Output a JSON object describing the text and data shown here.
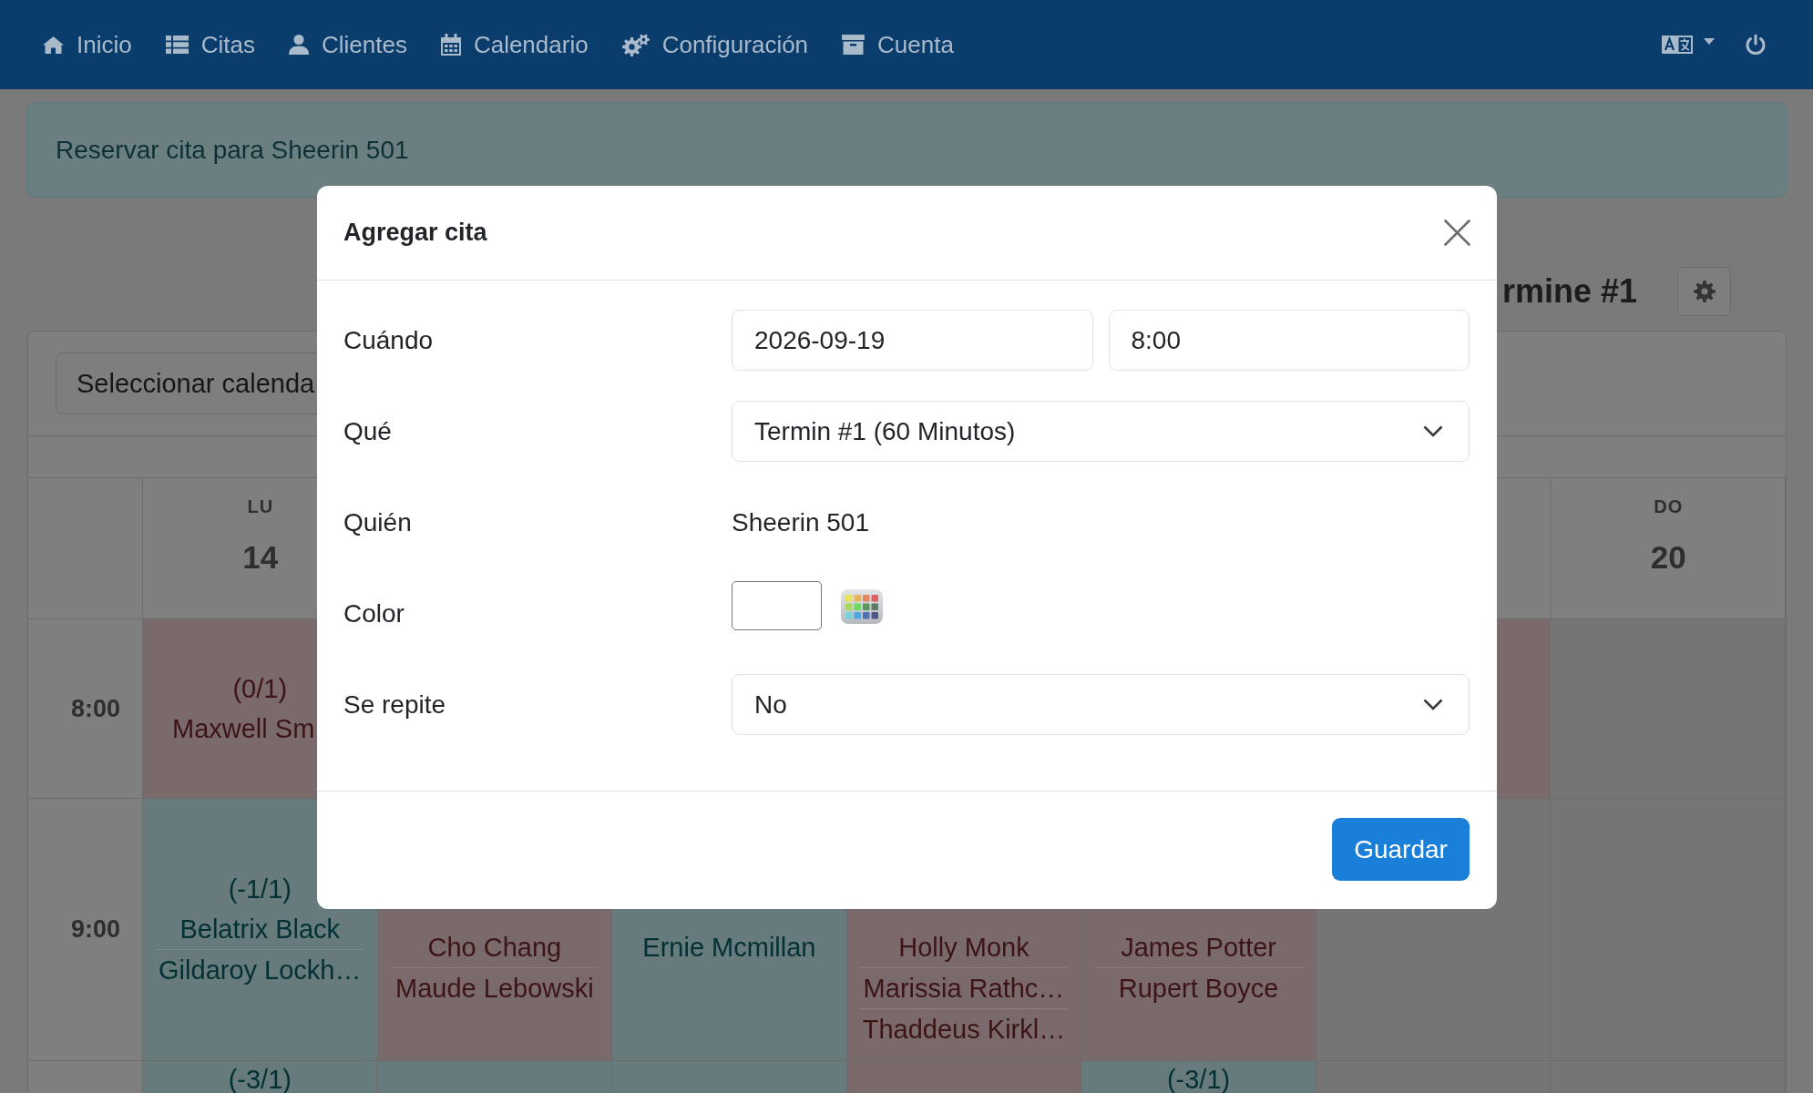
{
  "navbar": {
    "items": [
      "Inicio",
      "Citas",
      "Clientes",
      "Calendario",
      "Configuración",
      "Cuenta"
    ]
  },
  "alert": {
    "text": "Reservar cita para Sheerin 501"
  },
  "calendar": {
    "title": "rmine #1",
    "calendar_select": "Seleccionar calenda",
    "days": [
      {
        "weekday": "LU",
        "date": "14"
      },
      {
        "weekday": "DO",
        "date": "20"
      }
    ],
    "rows": [
      {
        "time": "8:00",
        "cells": [
          {
            "color": "#7b6a6b",
            "count": "(0/1)",
            "names": [
              "Maxwell Sm"
            ]
          },
          {},
          {},
          {},
          {},
          {
            "color": "#7b6a6b"
          },
          {
            "color": "#757577"
          }
        ]
      },
      {
        "time": "9:00",
        "cells": [
          {
            "color": "#677a7c",
            "count": "(-1/1)",
            "names": [
              "Belatrix Black",
              "Gildaroy Lockh…"
            ]
          },
          {
            "color": "#7b6a6b",
            "names": [
              "Cho Chang",
              "Maude Lebowski"
            ]
          },
          {
            "color": "#677a7c",
            "names": [
              "Ernie Mcmillan"
            ]
          },
          {
            "color": "#7b6a6b",
            "names": [
              "Holly Monk",
              "Marissia Rathc…",
              "Thaddeus Kirkl…"
            ]
          },
          {
            "color": "#7b6a6b",
            "names": [
              "James Potter",
              "Rupert Boyce"
            ]
          },
          {
            "color": "#757577"
          },
          {
            "color": "#757577"
          }
        ]
      },
      {
        "cells": [
          {
            "color": "#677a7c",
            "count": "(-3/1)"
          },
          {
            "color": "#677a7c"
          },
          {
            "color": "#677a7c"
          },
          {
            "color": "#7b6a6b"
          },
          {
            "color": "#677a7c",
            "count": "(-3/1)"
          },
          {
            "color": "#757577"
          },
          {
            "color": "#757577"
          }
        ]
      }
    ]
  },
  "dialog": {
    "title": "Agregar cita",
    "fields": [
      {
        "kind": "datetime",
        "label": "Cuándo",
        "date": "2026-09-19",
        "time": "8:00"
      },
      {
        "kind": "select",
        "label": "Qué",
        "value": "Termin #1 (60 Minutos)"
      },
      {
        "kind": "text",
        "label": "Quién",
        "value": "Sheerin 501"
      },
      {
        "kind": "color",
        "label": "Color"
      },
      {
        "kind": "select",
        "label": "Se repite",
        "value": "No"
      }
    ],
    "save_button": "Guardar"
  }
}
